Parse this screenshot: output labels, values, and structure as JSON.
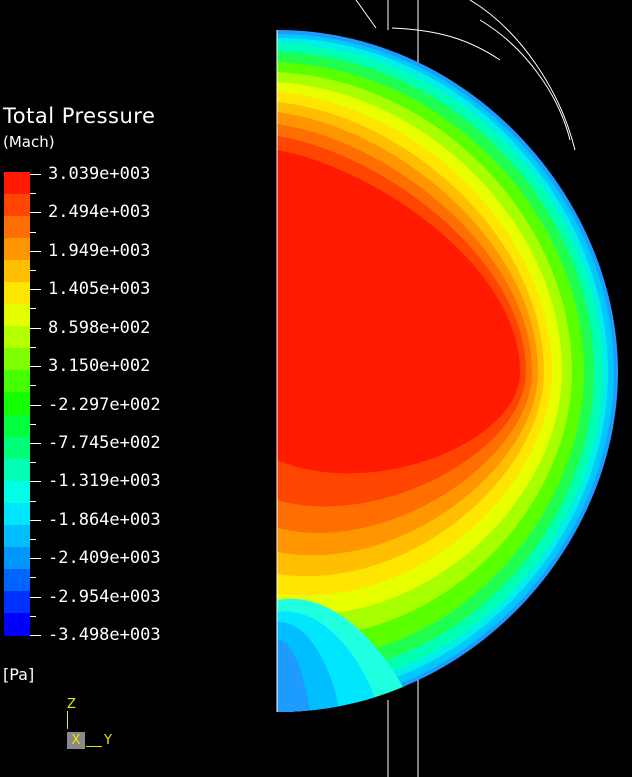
{
  "legend": {
    "title": "Total Pressure",
    "subtitle": "(Mach)",
    "unit": "[Pa]",
    "ticks": [
      "3.039e+003",
      "2.494e+003",
      "1.949e+003",
      "1.405e+003",
      "8.598e+002",
      "3.150e+002",
      "-2.297e+002",
      "-7.745e+002",
      "-1.319e+003",
      "-1.864e+003",
      "-2.409e+003",
      "-2.954e+003",
      "-3.498e+003"
    ],
    "colors": [
      "#ff1a00",
      "#ff4500",
      "#ff6e00",
      "#ff9600",
      "#ffbe00",
      "#ffe600",
      "#e6ff00",
      "#b4ff00",
      "#7dff00",
      "#46ff00",
      "#14ff00",
      "#00ff3c",
      "#00ff78",
      "#00ffb4",
      "#00ffe6",
      "#00e6ff",
      "#00beff",
      "#0096ff",
      "#0064ff",
      "#0032ff",
      "#0000ff"
    ]
  },
  "triad": {
    "z": "Z",
    "x": "X",
    "y": "Y"
  }
}
